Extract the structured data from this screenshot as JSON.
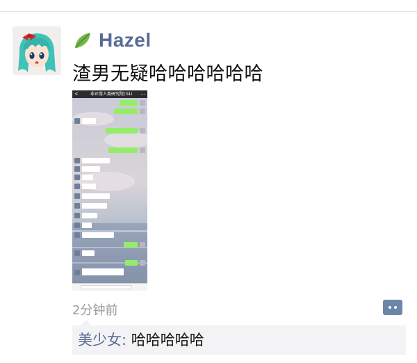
{
  "post": {
    "author": "Hazel",
    "text": "渣男无疑哈哈哈哈哈哈",
    "time": "2分钟前",
    "author_icon": "leaf-icon",
    "author_color": "#576b95"
  },
  "screenshot": {
    "title": "非正常人类研究院(34)",
    "back_glyph": "<",
    "more_glyph": "…"
  },
  "comments": [
    {
      "author": "美少女",
      "separator": ":",
      "text": "哈哈哈哈哈"
    }
  ],
  "icons": {
    "comment": "comment-icon",
    "avatar": "anime-girl-avatar"
  },
  "colors": {
    "link": "#576b95",
    "comment_bg": "#f3f3f5",
    "comment_button": "#6b86a8",
    "time": "#9b9b9b"
  }
}
